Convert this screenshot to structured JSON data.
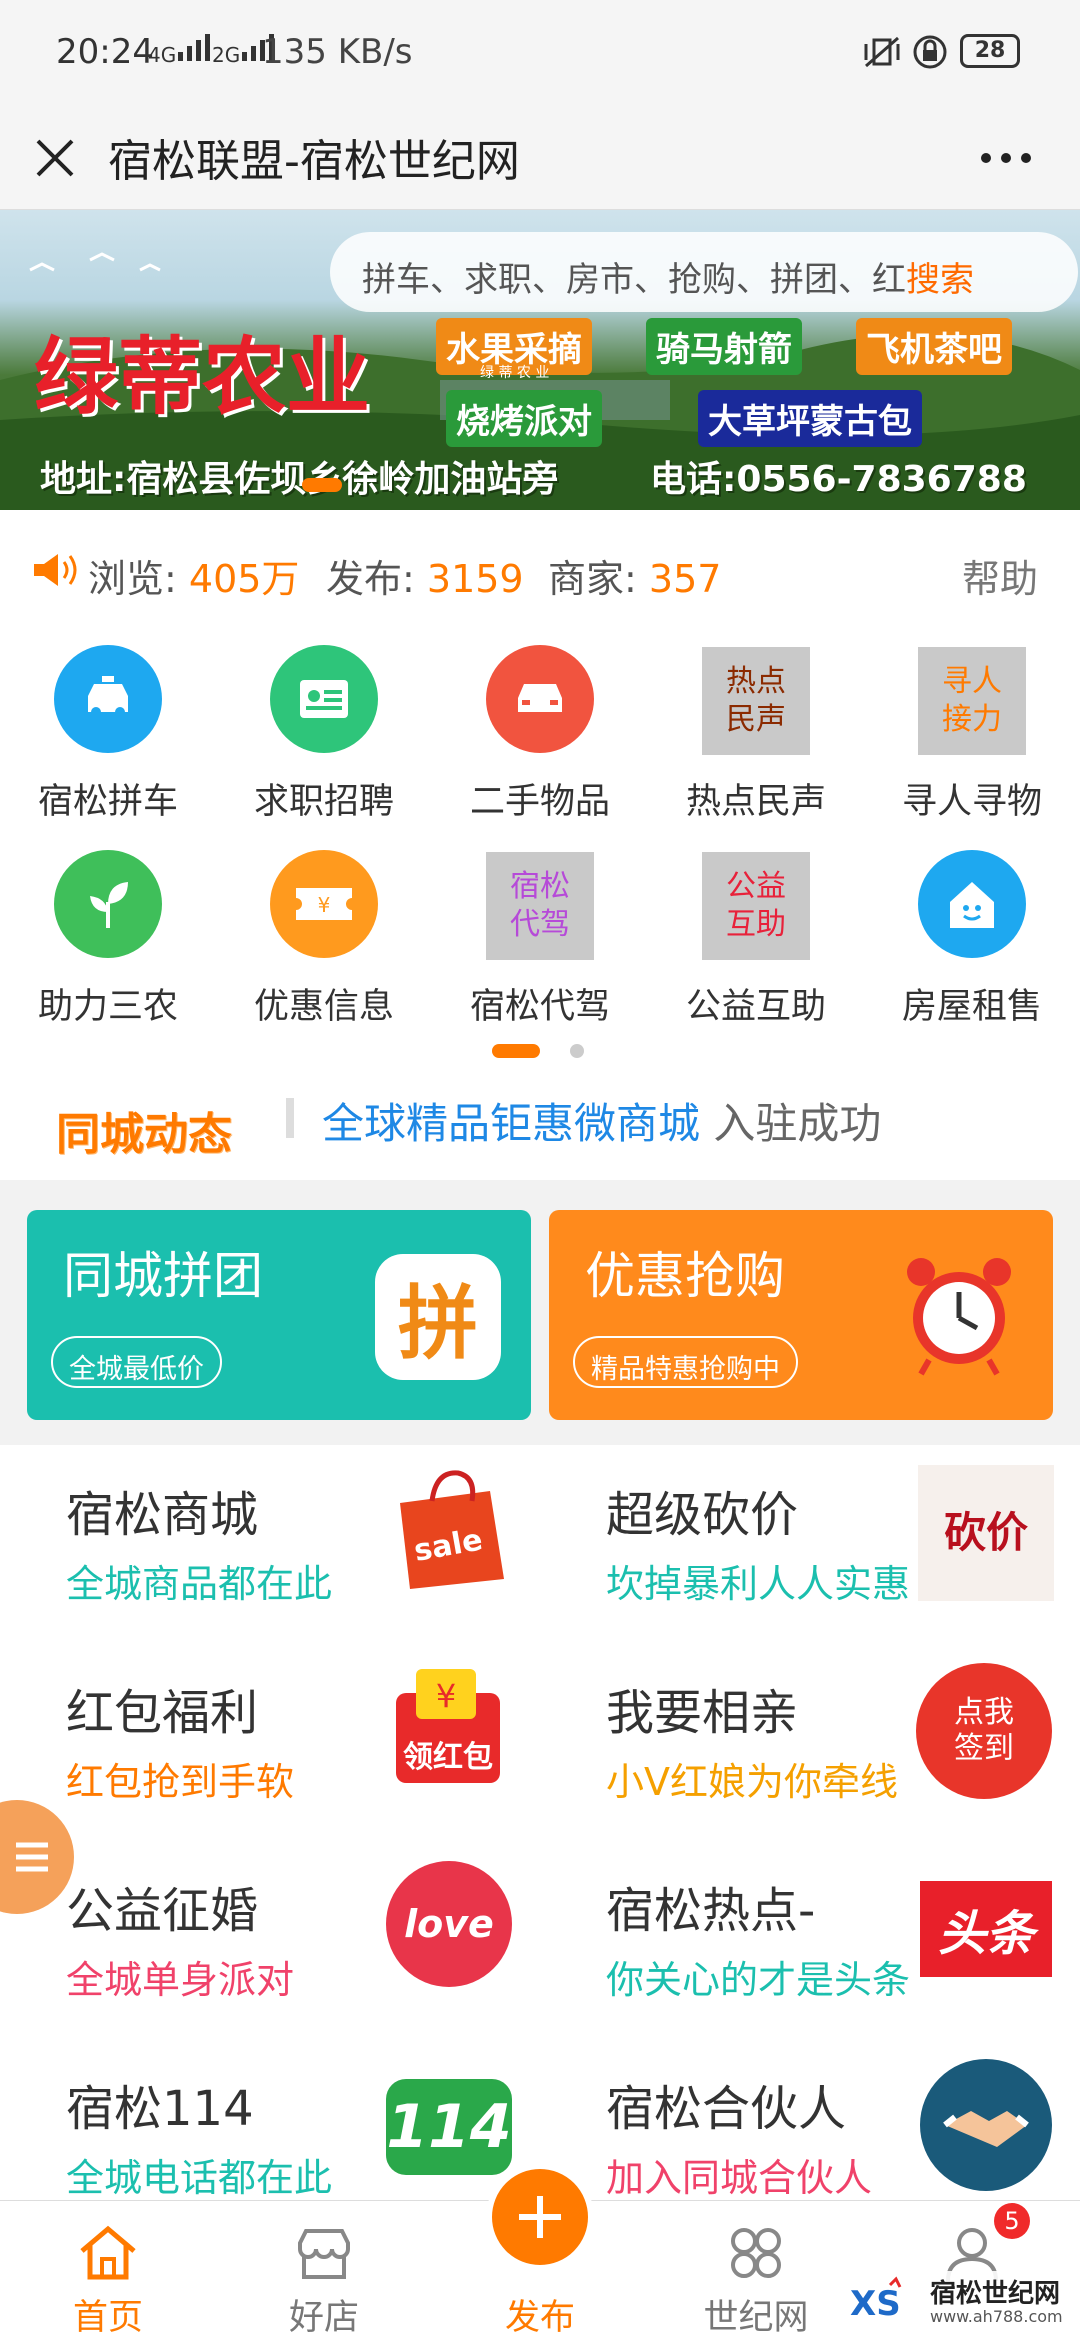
{
  "status_bar": {
    "time": "20:24",
    "net_speed": "135 KB/s",
    "sig1": "4G",
    "sig2": "2G",
    "battery": "28"
  },
  "titlebar": {
    "title": "宿松联盟-宿松世纪网"
  },
  "banner": {
    "search_placeholder": "拼车、求职、房市、抢购、拼团、红",
    "search_button": "搜索",
    "brand": "绿蒂农业",
    "tags": [
      "水果采摘",
      "骑马射箭",
      "飞机茶吧",
      "烧烤派对",
      "大草坪蒙古包"
    ],
    "sign_small": "绿 蒂 农 业",
    "address": "地址:宿松县佐坝乡徐岭加油站旁",
    "phone": "电话:0556-7836788"
  },
  "stats": {
    "views_label": "浏览:",
    "views_value": "405万",
    "posts_label": "发布:",
    "posts_value": "3159",
    "merchants_label": "商家:",
    "merchants_value": "357",
    "help": "帮助"
  },
  "categories": [
    {
      "label": "宿松拼车",
      "icon": "car-icon",
      "color": "#1ea8f0"
    },
    {
      "label": "求职招聘",
      "icon": "id-card-icon",
      "color": "#2ec57a"
    },
    {
      "label": "二手物品",
      "icon": "car-front-icon",
      "color": "#f1543f"
    },
    {
      "label": "热点民声",
      "icon_text": "热点\n民声",
      "text_color": "#8b2a00"
    },
    {
      "label": "寻人寻物",
      "icon_text": "寻人\n接力",
      "text_color": "#ff7a00"
    },
    {
      "label": "助力三农",
      "icon": "sprout-icon",
      "color": "#3fbf5a"
    },
    {
      "label": "优惠信息",
      "icon": "ticket-icon",
      "color": "#ff9a1e"
    },
    {
      "label": "宿松代驾",
      "icon_text": "宿松\n代驾",
      "text_color": "#b64ad8"
    },
    {
      "label": "公益互助",
      "icon_text": "公益\n互助",
      "text_color": "#e8213a"
    },
    {
      "label": "房屋租售",
      "icon": "house-icon",
      "color": "#1ea8f0"
    }
  ],
  "news": {
    "heading": "同城动态",
    "link": "全球精品钜惠微商城",
    "suffix": "入驻成功"
  },
  "promos": [
    {
      "title": "同城拼团",
      "pill": "全城最低价",
      "color": "#1bbfae",
      "icon_text": "拼"
    },
    {
      "title": "优惠抢购",
      "pill": "精品特惠抢购中",
      "color": "#ff8a1c"
    }
  ],
  "features": [
    {
      "title": "宿松商城",
      "sub": "全城商品都在此",
      "sub_color": "#1bbfae",
      "img_text": "sale"
    },
    {
      "title": "超级砍价",
      "sub": "坎掉暴利人人实惠",
      "sub_color": "#1bbfae",
      "img_text": "砍价"
    },
    {
      "title": "红包福利",
      "sub": "红包抢到手软",
      "sub_color": "#ff7a00",
      "img_text": "领红包"
    },
    {
      "title": "我要相亲",
      "sub": "小V红娘为你牵线",
      "sub_color": "#f5a000",
      "img_text": "点我\n签到"
    },
    {
      "title": "公益征婚",
      "sub": "全城单身派对",
      "sub_color": "#f0426a",
      "img_text": "love"
    },
    {
      "title": "宿松热点-",
      "sub": "你关心的才是头条",
      "sub_color": "#1bbfae",
      "img_text": "头条"
    },
    {
      "title": "宿松114",
      "sub": "全城电话都在此",
      "sub_color": "#1bbfae",
      "img_text": "114"
    },
    {
      "title": "宿松合伙人",
      "sub": "加入同城合伙人",
      "sub_color": "#f0426a",
      "img_text": ""
    }
  ],
  "tabbar": {
    "tabs": [
      "首页",
      "好店",
      "发布",
      "世纪网",
      ""
    ],
    "active_color": "#ff7a00",
    "badge": "5"
  },
  "watermark": {
    "text": "宿松世纪网",
    "url": "www.ah788.com"
  }
}
